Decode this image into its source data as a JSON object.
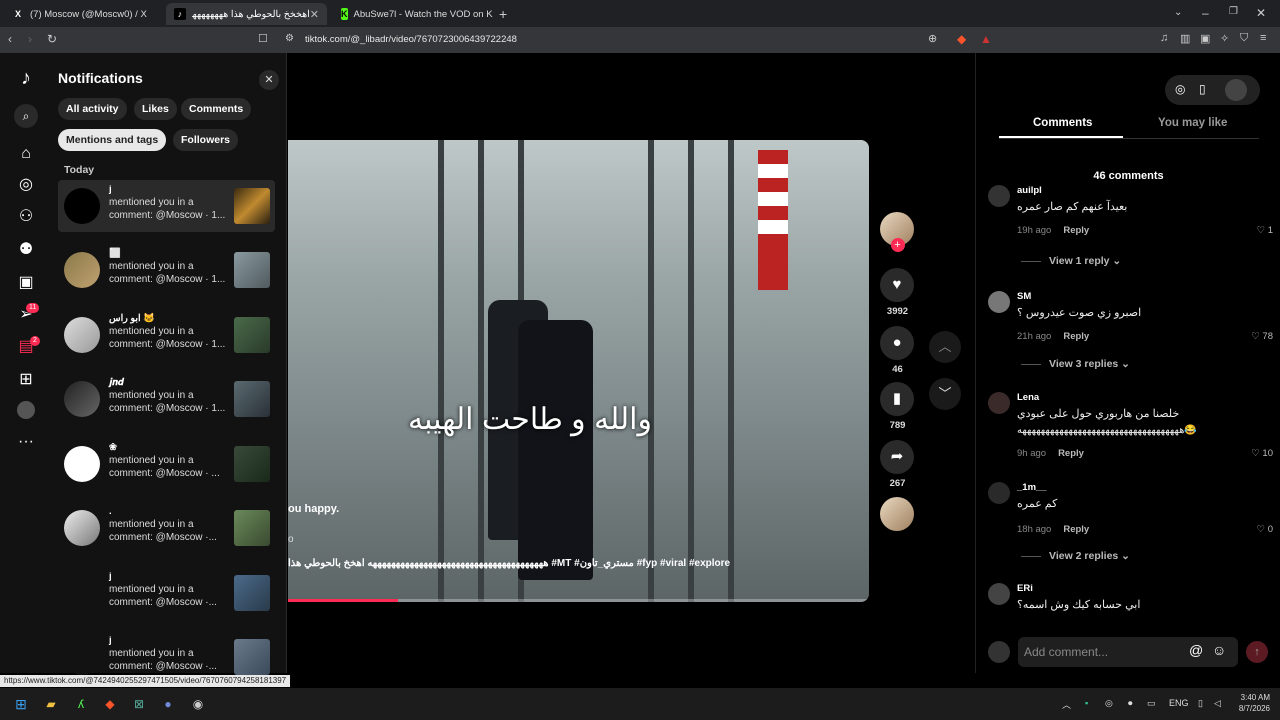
{
  "browser": {
    "tabs": [
      {
        "title": "(7) Moscow (@Moscw0) / X",
        "icon": "X",
        "active": false
      },
      {
        "title": "اهخخخ بالحوطي هذا هههههههههه",
        "icon": "♪",
        "active": true
      },
      {
        "title": "AbuSwe7l - Watch the VOD on Kick",
        "icon": "K",
        "active": false
      }
    ],
    "url": "tiktok.com/@_libadr/video/7670723006439722248",
    "status_url": "https://www.tiktok.com/@7424940255297471505/video/7670760794258181397"
  },
  "rail": {
    "messages_badge": "11",
    "inbox_badge": "2"
  },
  "notifications": {
    "title": "Notifications",
    "filters": [
      "All activity",
      "Likes",
      "Comments",
      "Mentions and tags",
      "Followers"
    ],
    "selected_filter": "Mentions and tags",
    "section": "Today",
    "items": [
      {
        "name": "j",
        "text": "mentioned you in a comment: @Moscow · 1..."
      },
      {
        "name": "⬜",
        "text": "mentioned you in a comment: @Moscow · 1..."
      },
      {
        "name": "ابو راس 🐱",
        "text": "mentioned you in a comment: @Moscow · 1..."
      },
      {
        "name": "𝒋𝒏𝒅",
        "text": "mentioned you in a comment: @Moscow · 1..."
      },
      {
        "name": "❀",
        "text": "mentioned you in a comment: @Moscow · ..."
      },
      {
        "name": ".",
        "text": "mentioned you in a comment: @Moscow ·..."
      },
      {
        "name": "j",
        "text": "mentioned you in a comment: @Moscow ·..."
      },
      {
        "name": "j",
        "text": "mentioned you in a comment: @Moscow ·..."
      }
    ]
  },
  "video": {
    "caption_overlay": "والله و طاحت الهيبه",
    "text_left": "ou happy.",
    "text_o": "o",
    "description": "ههههههههههههههههههههههههههههههههههههههه اهخخ بالحوطي هذا #MT #مستري_تاون #fyp #viral #explore",
    "progress": 0.19
  },
  "actions": {
    "likes": "3992",
    "comments": "46",
    "saves": "789",
    "shares": "267"
  },
  "comments_panel": {
    "tab_comments": "Comments",
    "tab_may_like": "You may like",
    "count": "46 comments",
    "reply_label": "Reply",
    "items": [
      {
        "user": "auilpl",
        "text": "بعيدآ عنهم كم صار عمره",
        "time": "19h ago",
        "likes": "1",
        "replies": "View 1 reply"
      },
      {
        "user": "SM",
        "text": "اصبرو زي صوت عيدروس ؟",
        "time": "21h ago",
        "likes": "78",
        "replies": "View 3 replies"
      },
      {
        "user": "Lena",
        "text": "خلصنا من هاربوري حول على عبودي",
        "text2": "هههههههههههههههههههههههههههههههههههه😂",
        "time": "9h ago",
        "likes": "10"
      },
      {
        "user": "_1m__",
        "text": "كم عمره",
        "time": "18h ago",
        "likes": "0",
        "replies": "View 2 replies"
      },
      {
        "user": "ERi",
        "text": "ابي حسابه كيك وش اسمه؟"
      }
    ],
    "input_placeholder": "Add comment..."
  },
  "taskbar": {
    "language": "ENG",
    "time": "3:40 AM",
    "date": "8/7/2026"
  }
}
